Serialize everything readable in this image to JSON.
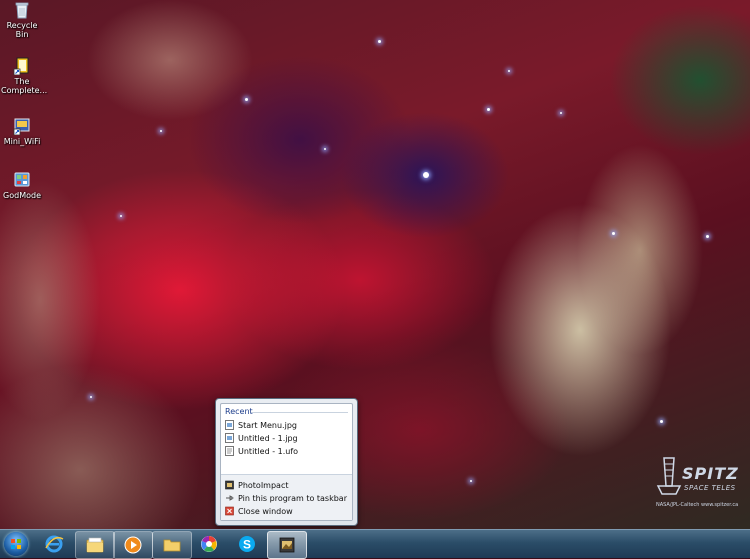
{
  "desktop_icons": [
    {
      "label": "Recycle Bin",
      "icon": "recycle-bin-icon"
    },
    {
      "label": "The Complete...",
      "icon": "shortcut-icon"
    },
    {
      "label": "Mini_WiFi",
      "icon": "wifi-icon"
    },
    {
      "label": "GodMode",
      "icon": "control-panel-icon"
    }
  ],
  "jumplist": {
    "header": "Recent",
    "recent": [
      "Start Menu.jpg",
      "Untitled - 1.jpg",
      "Untitled - 1.ufo"
    ],
    "program": "PhotoImpact",
    "pin": "Pin this program to taskbar",
    "close": "Close window"
  },
  "taskbar": {
    "start": "start-button",
    "buttons": [
      {
        "icon": "internet-explorer-icon",
        "state": "pinned"
      },
      {
        "icon": "windows-explorer-icon",
        "state": "running"
      },
      {
        "icon": "media-player-icon",
        "state": "running"
      },
      {
        "icon": "folder-icon",
        "state": "running"
      },
      {
        "icon": "picasa-icon",
        "state": "pinned"
      },
      {
        "icon": "skype-icon",
        "state": "pinned"
      },
      {
        "icon": "photoimpact-icon",
        "state": "active"
      }
    ]
  },
  "watermark": {
    "word": "SPITZ",
    "sub": "SPACE TELES",
    "credit": "NASA/JPL-Caltech   www.spitzer.ca"
  },
  "colors": {
    "jumplist_header": "#1e3e8c",
    "taskbar": "#2b4d68"
  }
}
